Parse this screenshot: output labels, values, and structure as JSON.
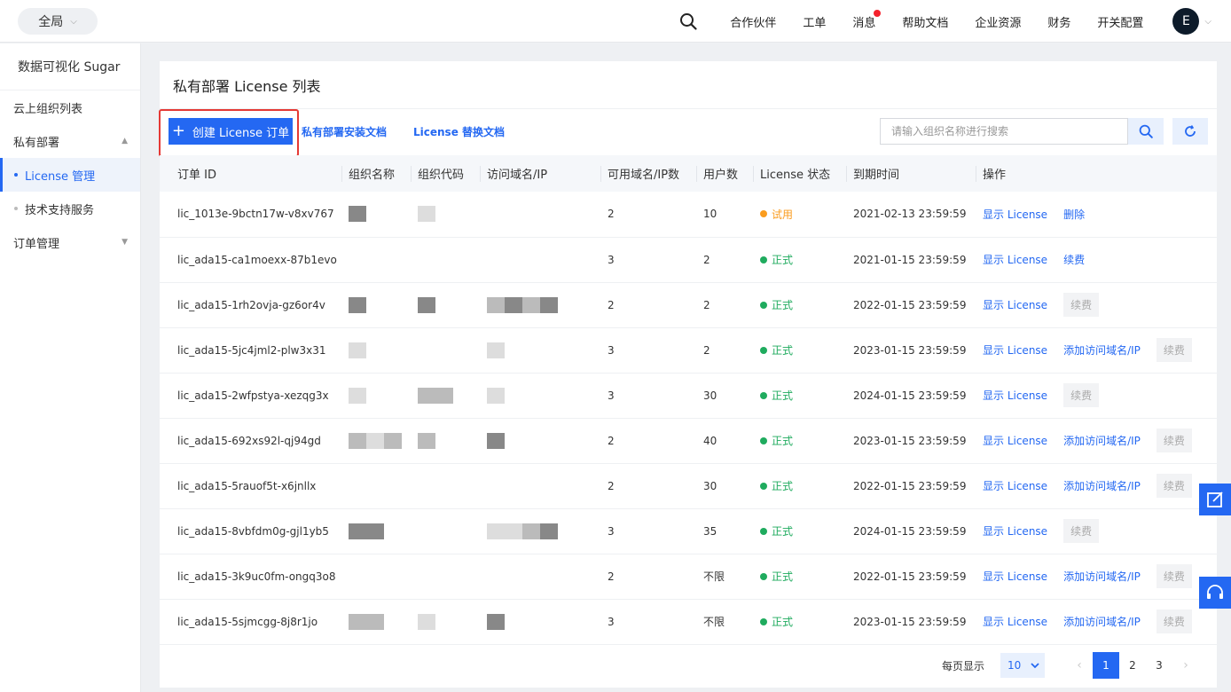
{
  "topbar": {
    "scope": "全局",
    "nav": [
      {
        "label": "合作伙伴",
        "badge": false
      },
      {
        "label": "工单",
        "badge": false
      },
      {
        "label": "消息",
        "badge": true
      },
      {
        "label": "帮助文档",
        "badge": false
      },
      {
        "label": "企业资源",
        "badge": false
      },
      {
        "label": "财务",
        "badge": false
      },
      {
        "label": "开关配置",
        "badge": false
      }
    ],
    "avatar": "E"
  },
  "sidebar": {
    "title": "数据可视化 Sugar",
    "items": [
      {
        "label": "云上组织列表"
      },
      {
        "label": "私有部署",
        "chevron": "up"
      },
      {
        "label": "License 管理",
        "active": true
      },
      {
        "label": "技术支持服务"
      },
      {
        "label": "订单管理",
        "chevron": "down"
      }
    ]
  },
  "page": {
    "title": "私有部署 License 列表",
    "create_label": "创建 License 订单",
    "doc_link_1": "私有部署安装文档",
    "doc_link_2": "License 替换文档",
    "search_placeholder": "请输入组织名称进行搜索"
  },
  "table": {
    "headers": [
      "订单 ID",
      "组织名称",
      "组织代码",
      "访问域名/IP",
      "可用域名/IP数",
      "用户数",
      "License 状态",
      "到期时间",
      "操作"
    ],
    "rows": [
      {
        "id": "lic_1013e-9bctn17w-v8xv767",
        "domains": "2",
        "users": "10",
        "status": "试用",
        "status_color": "#fa9c1e",
        "expire": "2021-02-13 23:59:59",
        "actions": [
          "显示 License",
          "删除"
        ],
        "button": ""
      },
      {
        "id": "lic_ada15-ca1moexx-87b1evo",
        "domains": "3",
        "users": "2",
        "status": "正式",
        "status_color": "#1fab5e",
        "expire": "2021-01-15 23:59:59",
        "actions": [
          "显示 License",
          "续费"
        ],
        "button": ""
      },
      {
        "id": "lic_ada15-1rh2ovja-gz6or4v",
        "domains": "2",
        "users": "2",
        "status": "正式",
        "status_color": "#1fab5e",
        "expire": "2022-01-15 23:59:59",
        "actions": [
          "显示 License"
        ],
        "button": "续费"
      },
      {
        "id": "lic_ada15-5jc4jml2-plw3x31",
        "domains": "3",
        "users": "2",
        "status": "正式",
        "status_color": "#1fab5e",
        "expire": "2023-01-15 23:59:59",
        "actions": [
          "显示 License",
          "添加访问域名/IP"
        ],
        "button": "续费"
      },
      {
        "id": "lic_ada15-2wfpstya-xezqg3x",
        "domains": "3",
        "users": "30",
        "status": "正式",
        "status_color": "#1fab5e",
        "expire": "2024-01-15 23:59:59",
        "actions": [
          "显示 License"
        ],
        "button": "续费"
      },
      {
        "id": "lic_ada15-692xs92l-qj94gd",
        "domains": "2",
        "users": "40",
        "status": "正式",
        "status_color": "#1fab5e",
        "expire": "2023-01-15 23:59:59",
        "actions": [
          "显示 License",
          "添加访问域名/IP"
        ],
        "button": "续费"
      },
      {
        "id": "lic_ada15-5rauof5t-x6jnllx",
        "domains": "2",
        "users": "30",
        "status": "正式",
        "status_color": "#1fab5e",
        "expire": "2022-01-15 23:59:59",
        "actions": [
          "显示 License",
          "添加访问域名/IP"
        ],
        "button": "续费"
      },
      {
        "id": "lic_ada15-8vbfdm0g-gjl1yb5",
        "domains": "3",
        "users": "35",
        "status": "正式",
        "status_color": "#1fab5e",
        "expire": "2024-01-15 23:59:59",
        "actions": [
          "显示 License"
        ],
        "button": "续费"
      },
      {
        "id": "lic_ada15-3k9uc0fm-ongq3o8",
        "domains": "2",
        "users": "不限",
        "status": "正式",
        "status_color": "#1fab5e",
        "expire": "2022-01-15 23:59:59",
        "actions": [
          "显示 License",
          "添加访问域名/IP"
        ],
        "button": "续费"
      },
      {
        "id": "lic_ada15-5sjmcgg-8j8r1jo",
        "domains": "3",
        "users": "不限",
        "status": "正式",
        "status_color": "#1fab5e",
        "expire": "2023-01-15 23:59:59",
        "actions": [
          "显示 License",
          "添加访问域名/IP"
        ],
        "button": "续费"
      }
    ]
  },
  "pagination": {
    "per_page_label": "每页显示",
    "per_page": "10",
    "pages": [
      "1",
      "2",
      "3"
    ],
    "current": "1"
  },
  "colors": {
    "accent": "#2468f2",
    "trial": "#fa9c1e",
    "formal": "#1fab5e",
    "highlight": "#e53935"
  }
}
